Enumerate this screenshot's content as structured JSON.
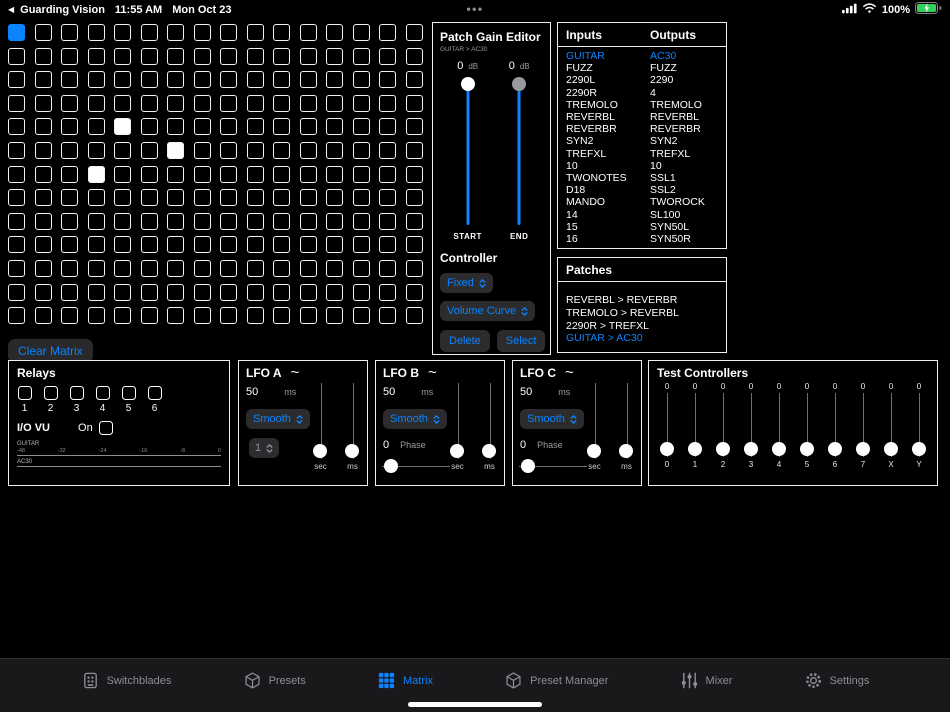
{
  "colors": {
    "accent": "#0a84ff",
    "matrix_on": "#ffffff",
    "battery_green": "#30d158"
  },
  "status_bar": {
    "back_app": "Guarding Vision",
    "time": "11:55 AM",
    "date": "Mon Oct 23",
    "battery": "100%"
  },
  "matrix": {
    "rows": 13,
    "cols": 16,
    "clear_button": "Clear Matrix",
    "active_cells": [
      {
        "row": 0,
        "col": 0,
        "state": "selected"
      },
      {
        "row": 4,
        "col": 4,
        "state": "on"
      },
      {
        "row": 5,
        "col": 6,
        "state": "on"
      },
      {
        "row": 6,
        "col": 3,
        "state": "on"
      }
    ]
  },
  "patch_gain_editor": {
    "title": "Patch Gain Editor",
    "subtitle": "GUITAR > AC30",
    "sliders": [
      {
        "value": "0",
        "unit": "dB",
        "label": "START"
      },
      {
        "value": "0",
        "unit": "dB",
        "label": "END"
      }
    ],
    "controller_label": "Controller",
    "controller_type": "Fixed",
    "curve_type": "Volume Curve",
    "delete_button": "Delete",
    "select_button": "Select"
  },
  "io_panel": {
    "inputs_header": "Inputs",
    "outputs_header": "Outputs",
    "inputs": [
      "GUITAR",
      "FUZZ",
      "2290L",
      "2290R",
      "TREMOLO",
      "REVERBL",
      "REVERBR",
      "SYN2",
      "TREFXL",
      "10",
      "TWONOTES",
      "D18",
      "MANDO",
      "14",
      "15",
      "16"
    ],
    "outputs": [
      "AC30",
      "FUZZ",
      "2290",
      "4",
      "TREMOLO",
      "REVERBL",
      "REVERBR",
      "SYN2",
      "TREFXL",
      "10",
      "SSL1",
      "SSL2",
      "TWOROCK",
      "SL100",
      "SYN50L",
      "SYN50R"
    ],
    "selected_input": "GUITAR",
    "selected_output": "AC30"
  },
  "patches_panel": {
    "header": "Patches",
    "items": [
      "REVERBL > REVERBR",
      "TREMOLO > REVERBL",
      "2290R > TREFXL",
      "GUITAR > AC30"
    ],
    "selected": "GUITAR > AC30"
  },
  "relays": {
    "title": "Relays",
    "numbers": [
      "1",
      "2",
      "3",
      "4",
      "5",
      "6"
    ],
    "io_vu_label": "I/O VU",
    "on_label": "On",
    "vu_source": "GUITAR",
    "vu_dest": "AC30",
    "scale": [
      "-48",
      "-32",
      "-24",
      "-16",
      "-8",
      "0"
    ]
  },
  "lfos": [
    {
      "title": "LFO A",
      "wave_symbol": "~",
      "rate_value": "50",
      "rate_unit": "ms",
      "shape": "Smooth",
      "divider": "1",
      "knob_labels": [
        "sec",
        "ms"
      ]
    },
    {
      "title": "LFO B",
      "wave_symbol": "~",
      "rate_value": "50",
      "rate_unit": "ms",
      "shape": "Smooth",
      "phase_value": "0",
      "phase_label": "Phase",
      "knob_labels": [
        "sec",
        "ms"
      ]
    },
    {
      "title": "LFO C",
      "wave_symbol": "~",
      "rate_value": "50",
      "rate_unit": "ms",
      "shape": "Smooth",
      "phase_value": "0",
      "phase_label": "Phase",
      "knob_labels": [
        "sec",
        "ms"
      ]
    }
  ],
  "test_controllers": {
    "title": "Test Controllers",
    "sliders": [
      {
        "value": "0",
        "label": "0"
      },
      {
        "value": "0",
        "label": "1"
      },
      {
        "value": "0",
        "label": "2"
      },
      {
        "value": "0",
        "label": "3"
      },
      {
        "value": "0",
        "label": "4"
      },
      {
        "value": "0",
        "label": "5"
      },
      {
        "value": "0",
        "label": "6"
      },
      {
        "value": "0",
        "label": "7"
      },
      {
        "value": "0",
        "label": "X"
      },
      {
        "value": "0",
        "label": "Y"
      }
    ]
  },
  "tab_bar": {
    "tabs": [
      {
        "label": "Switchblades",
        "icon": "switchblade-icon",
        "active": false
      },
      {
        "label": "Presets",
        "icon": "cube-icon",
        "active": false
      },
      {
        "label": "Matrix",
        "icon": "grid-icon",
        "active": true
      },
      {
        "label": "Preset Manager",
        "icon": "cube-icon",
        "active": false
      },
      {
        "label": "Mixer",
        "icon": "sliders-icon",
        "active": false
      },
      {
        "label": "Settings",
        "icon": "gear-icon",
        "active": false
      }
    ]
  }
}
